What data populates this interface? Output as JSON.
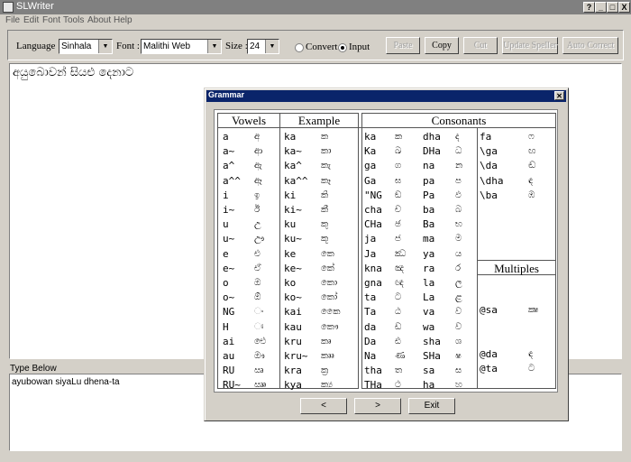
{
  "window": {
    "title": "SLWriter",
    "buttons": [
      "?",
      "_",
      "□",
      "X"
    ]
  },
  "menu": [
    "File",
    "Edit",
    "Font",
    "Tools",
    "About",
    "Help"
  ],
  "toolbar": {
    "language_label": "Language :",
    "language_value": "Sinhala",
    "font_label": "Font :",
    "font_value": "Malithi Web",
    "size_label": "Size :",
    "size_value": "24",
    "convert_label": "Convert",
    "input_label": "Input",
    "mode_selected": "Input",
    "buttons": {
      "paste": "Paste",
      "copy": "Copy",
      "cut": "Cut",
      "update_speller": "Update Speller",
      "auto_correct": "Auto Correct"
    }
  },
  "output_text": "අයුබොවන් සියළු දෙනාට",
  "type_below_label": "Type Below",
  "input_text": "ayubowan siyaLu dhena-ta",
  "dialog": {
    "title": "Grammar",
    "close": "✕",
    "headers": {
      "vowels": "Vowels",
      "example": "Example",
      "consonants": "Consonants",
      "multiples": "Multiples"
    },
    "vowels": [
      [
        "a",
        "අ"
      ],
      [
        "a~",
        "ආ"
      ],
      [
        "a^",
        "ඇ"
      ],
      [
        "a^^",
        "ඈ"
      ],
      [
        "i",
        "ඉ"
      ],
      [
        "i~",
        "ඊ"
      ],
      [
        "u",
        "උ"
      ],
      [
        "u~",
        "ඌ"
      ],
      [
        "e",
        "එ"
      ],
      [
        "e~",
        "ඒ"
      ],
      [
        "o",
        "ඔ"
      ],
      [
        "o~",
        "ඕ"
      ],
      [
        "NG",
        "ං"
      ],
      [
        "H",
        "ඃ"
      ],
      [
        "ai",
        "ඓ"
      ],
      [
        "au",
        "ඖ"
      ],
      [
        "RU",
        "ඍ"
      ],
      [
        "RU~",
        "ඎ"
      ]
    ],
    "examples": [
      [
        "ka",
        "ක"
      ],
      [
        "ka~",
        "කා"
      ],
      [
        "ka^",
        "කැ"
      ],
      [
        "ka^^",
        "කෑ"
      ],
      [
        "ki",
        "කි"
      ],
      [
        "ki~",
        "කී"
      ],
      [
        "ku",
        "කු"
      ],
      [
        "ku~",
        "කූ"
      ],
      [
        "ke",
        "කෙ"
      ],
      [
        "ke~",
        "කේ"
      ],
      [
        "ko",
        "කො"
      ],
      [
        "ko~",
        "කෝ"
      ],
      [
        "kai",
        "කෛ"
      ],
      [
        "kau",
        "කෞ"
      ],
      [
        "kru",
        "කෘ"
      ],
      [
        "kru~",
        "කෲ"
      ],
      [
        "kra",
        "ක්‍ර"
      ],
      [
        "kya",
        "ක්‍ය"
      ]
    ],
    "consonants_1": [
      [
        "ka",
        "ක"
      ],
      [
        "Ka",
        "ඛ"
      ],
      [
        "ga",
        "ග"
      ],
      [
        "Ga",
        "ඝ"
      ],
      [
        "\"NG",
        "ඞ"
      ],
      [
        "cha",
        "ච"
      ],
      [
        "CHa",
        "ඡ"
      ],
      [
        "ja",
        "ජ"
      ],
      [
        "Ja",
        "ඣ"
      ],
      [
        "kna",
        "ඤ"
      ],
      [
        "gna",
        "ඥ"
      ],
      [
        "ta",
        "ට"
      ],
      [
        "Ta",
        "ඨ"
      ],
      [
        "da",
        "ඩ"
      ],
      [
        "Da",
        "ඪ"
      ],
      [
        "Na",
        "ණ"
      ],
      [
        "tha",
        "ත"
      ],
      [
        "THa",
        "ථ"
      ]
    ],
    "consonants_2": [
      [
        "dha",
        "ද"
      ],
      [
        "DHa",
        "ධ"
      ],
      [
        "na",
        "න"
      ],
      [
        "pa",
        "ප"
      ],
      [
        "Pa",
        "ඵ"
      ],
      [
        "ba",
        "බ"
      ],
      [
        "Ba",
        "භ"
      ],
      [
        "ma",
        "ම"
      ],
      [
        "ya",
        "ය"
      ],
      [
        "ra",
        "ර"
      ],
      [
        "la",
        "ල"
      ],
      [
        "La",
        "ළ"
      ],
      [
        "va",
        "ව"
      ],
      [
        "wa",
        "ව"
      ],
      [
        "sha",
        "ශ"
      ],
      [
        "SHa",
        "ෂ"
      ],
      [
        "sa",
        "ස"
      ],
      [
        "ha",
        "හ"
      ]
    ],
    "consonants_3": [
      [
        "fa",
        "ෆ"
      ],
      [
        "\\ga",
        "ඟ"
      ],
      [
        "\\da",
        "ඬ"
      ],
      [
        "\\dha",
        "ඳ"
      ],
      [
        "\\ba",
        "ඹ"
      ]
    ],
    "multiples": [
      [
        "@sa",
        "ක්‍ෂ"
      ],
      [
        "@da",
        "ඳ"
      ],
      [
        "@ta",
        "ට"
      ]
    ],
    "buttons": {
      "prev": "<",
      "next": ">",
      "exit": "Exit"
    }
  }
}
